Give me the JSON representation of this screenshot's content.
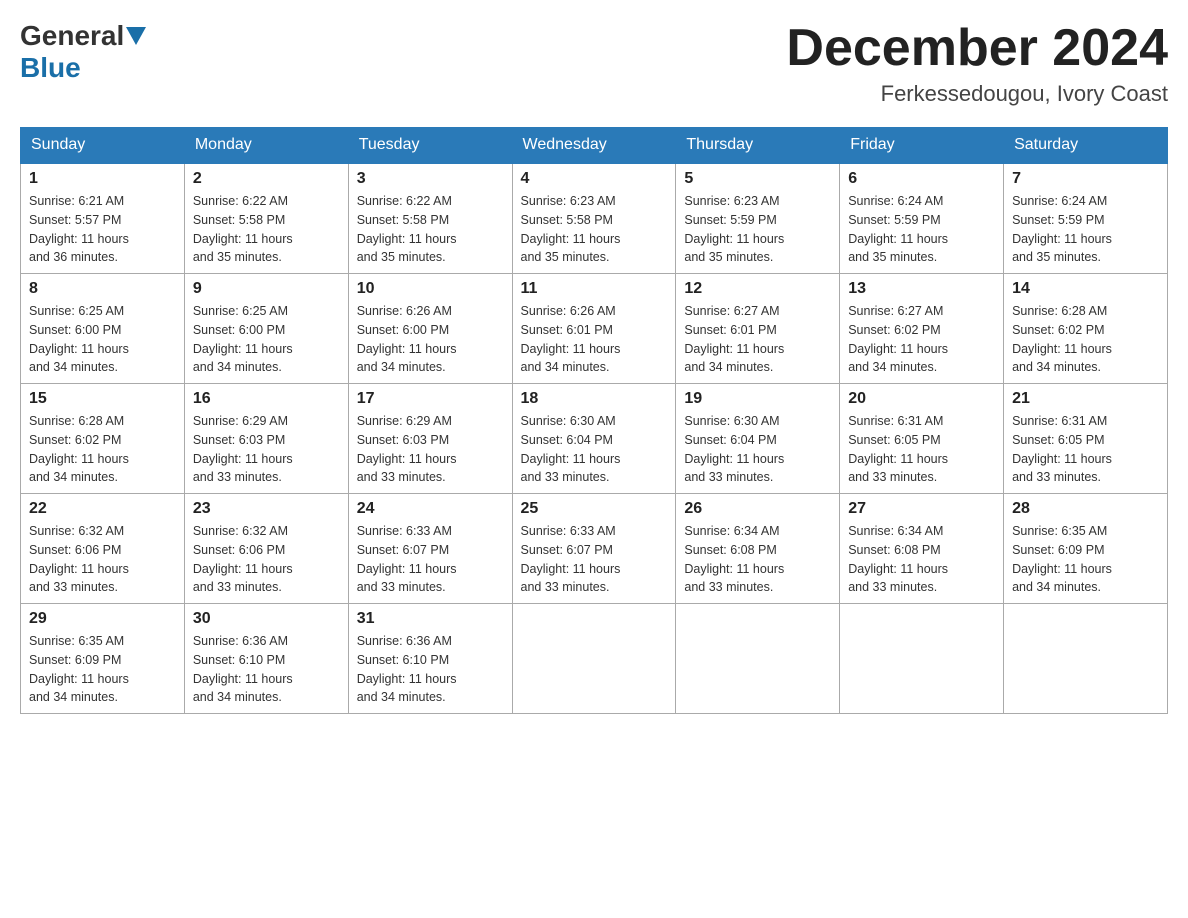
{
  "header": {
    "logo_general": "General",
    "logo_blue": "Blue",
    "month_title": "December 2024",
    "location": "Ferkessedougou, Ivory Coast"
  },
  "days_of_week": [
    "Sunday",
    "Monday",
    "Tuesday",
    "Wednesday",
    "Thursday",
    "Friday",
    "Saturday"
  ],
  "weeks": [
    [
      {
        "day": "1",
        "sunrise": "6:21 AM",
        "sunset": "5:57 PM",
        "daylight": "11 hours and 36 minutes."
      },
      {
        "day": "2",
        "sunrise": "6:22 AM",
        "sunset": "5:58 PM",
        "daylight": "11 hours and 35 minutes."
      },
      {
        "day": "3",
        "sunrise": "6:22 AM",
        "sunset": "5:58 PM",
        "daylight": "11 hours and 35 minutes."
      },
      {
        "day": "4",
        "sunrise": "6:23 AM",
        "sunset": "5:58 PM",
        "daylight": "11 hours and 35 minutes."
      },
      {
        "day": "5",
        "sunrise": "6:23 AM",
        "sunset": "5:59 PM",
        "daylight": "11 hours and 35 minutes."
      },
      {
        "day": "6",
        "sunrise": "6:24 AM",
        "sunset": "5:59 PM",
        "daylight": "11 hours and 35 minutes."
      },
      {
        "day": "7",
        "sunrise": "6:24 AM",
        "sunset": "5:59 PM",
        "daylight": "11 hours and 35 minutes."
      }
    ],
    [
      {
        "day": "8",
        "sunrise": "6:25 AM",
        "sunset": "6:00 PM",
        "daylight": "11 hours and 34 minutes."
      },
      {
        "day": "9",
        "sunrise": "6:25 AM",
        "sunset": "6:00 PM",
        "daylight": "11 hours and 34 minutes."
      },
      {
        "day": "10",
        "sunrise": "6:26 AM",
        "sunset": "6:00 PM",
        "daylight": "11 hours and 34 minutes."
      },
      {
        "day": "11",
        "sunrise": "6:26 AM",
        "sunset": "6:01 PM",
        "daylight": "11 hours and 34 minutes."
      },
      {
        "day": "12",
        "sunrise": "6:27 AM",
        "sunset": "6:01 PM",
        "daylight": "11 hours and 34 minutes."
      },
      {
        "day": "13",
        "sunrise": "6:27 AM",
        "sunset": "6:02 PM",
        "daylight": "11 hours and 34 minutes."
      },
      {
        "day": "14",
        "sunrise": "6:28 AM",
        "sunset": "6:02 PM",
        "daylight": "11 hours and 34 minutes."
      }
    ],
    [
      {
        "day": "15",
        "sunrise": "6:28 AM",
        "sunset": "6:02 PM",
        "daylight": "11 hours and 34 minutes."
      },
      {
        "day": "16",
        "sunrise": "6:29 AM",
        "sunset": "6:03 PM",
        "daylight": "11 hours and 33 minutes."
      },
      {
        "day": "17",
        "sunrise": "6:29 AM",
        "sunset": "6:03 PM",
        "daylight": "11 hours and 33 minutes."
      },
      {
        "day": "18",
        "sunrise": "6:30 AM",
        "sunset": "6:04 PM",
        "daylight": "11 hours and 33 minutes."
      },
      {
        "day": "19",
        "sunrise": "6:30 AM",
        "sunset": "6:04 PM",
        "daylight": "11 hours and 33 minutes."
      },
      {
        "day": "20",
        "sunrise": "6:31 AM",
        "sunset": "6:05 PM",
        "daylight": "11 hours and 33 minutes."
      },
      {
        "day": "21",
        "sunrise": "6:31 AM",
        "sunset": "6:05 PM",
        "daylight": "11 hours and 33 minutes."
      }
    ],
    [
      {
        "day": "22",
        "sunrise": "6:32 AM",
        "sunset": "6:06 PM",
        "daylight": "11 hours and 33 minutes."
      },
      {
        "day": "23",
        "sunrise": "6:32 AM",
        "sunset": "6:06 PM",
        "daylight": "11 hours and 33 minutes."
      },
      {
        "day": "24",
        "sunrise": "6:33 AM",
        "sunset": "6:07 PM",
        "daylight": "11 hours and 33 minutes."
      },
      {
        "day": "25",
        "sunrise": "6:33 AM",
        "sunset": "6:07 PM",
        "daylight": "11 hours and 33 minutes."
      },
      {
        "day": "26",
        "sunrise": "6:34 AM",
        "sunset": "6:08 PM",
        "daylight": "11 hours and 33 minutes."
      },
      {
        "day": "27",
        "sunrise": "6:34 AM",
        "sunset": "6:08 PM",
        "daylight": "11 hours and 33 minutes."
      },
      {
        "day": "28",
        "sunrise": "6:35 AM",
        "sunset": "6:09 PM",
        "daylight": "11 hours and 34 minutes."
      }
    ],
    [
      {
        "day": "29",
        "sunrise": "6:35 AM",
        "sunset": "6:09 PM",
        "daylight": "11 hours and 34 minutes."
      },
      {
        "day": "30",
        "sunrise": "6:36 AM",
        "sunset": "6:10 PM",
        "daylight": "11 hours and 34 minutes."
      },
      {
        "day": "31",
        "sunrise": "6:36 AM",
        "sunset": "6:10 PM",
        "daylight": "11 hours and 34 minutes."
      },
      null,
      null,
      null,
      null
    ]
  ],
  "labels": {
    "sunrise": "Sunrise:",
    "sunset": "Sunset:",
    "daylight": "Daylight:"
  }
}
